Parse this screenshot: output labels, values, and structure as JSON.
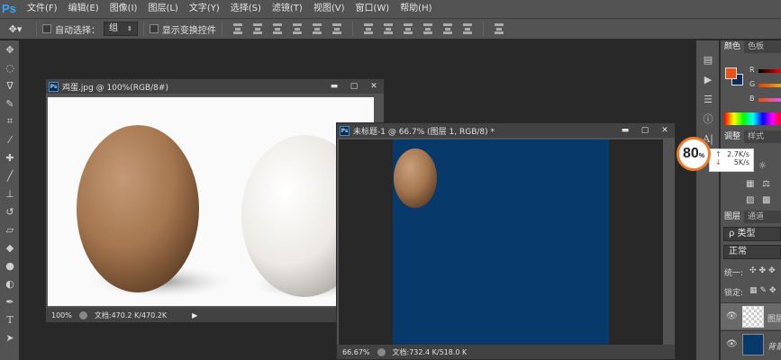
{
  "app": {
    "logo": "Ps"
  },
  "menu": [
    "文件(F)",
    "编辑(E)",
    "图像(I)",
    "图层(L)",
    "文字(Y)",
    "选择(S)",
    "滤镜(T)",
    "视图(V)",
    "窗口(W)",
    "帮助(H)"
  ],
  "options": {
    "auto_select_label": "自动选择：",
    "auto_select_value": "组",
    "show_transform_label": "显示变换控件"
  },
  "doc1": {
    "title": "鸡蛋.jpg @ 100%(RGB/8#)",
    "zoom": "100%",
    "docsize": "文档:470.2 K/470.2K"
  },
  "doc2": {
    "title": "未标题-1 @ 66.7% (图层 1, RGB/8) *",
    "zoom": "66.67%",
    "docsize": "文档:732.4 K/518.0 K",
    "background_color": "#073a6a"
  },
  "net": {
    "percent": "80",
    "percent_unit": "%",
    "up": "2.7K/s",
    "down": "5K/s"
  },
  "panels": {
    "color_tabs": [
      "颜色",
      "色板"
    ],
    "color_channels": [
      "R",
      "G",
      "B"
    ],
    "adjust_tabs": [
      "调整",
      "样式"
    ],
    "layer_tabs": [
      "图层",
      "通道"
    ],
    "kind_filter": "ρ 类型",
    "blend_mode": "正常",
    "unify_label": "统一:",
    "lock_label": "锁定:",
    "layer1_name": "图层",
    "layer2_name": "背景"
  },
  "colors": {
    "foreground": "#e8531a",
    "background": "#102b5a",
    "accent_orange": "#f07a2a"
  }
}
